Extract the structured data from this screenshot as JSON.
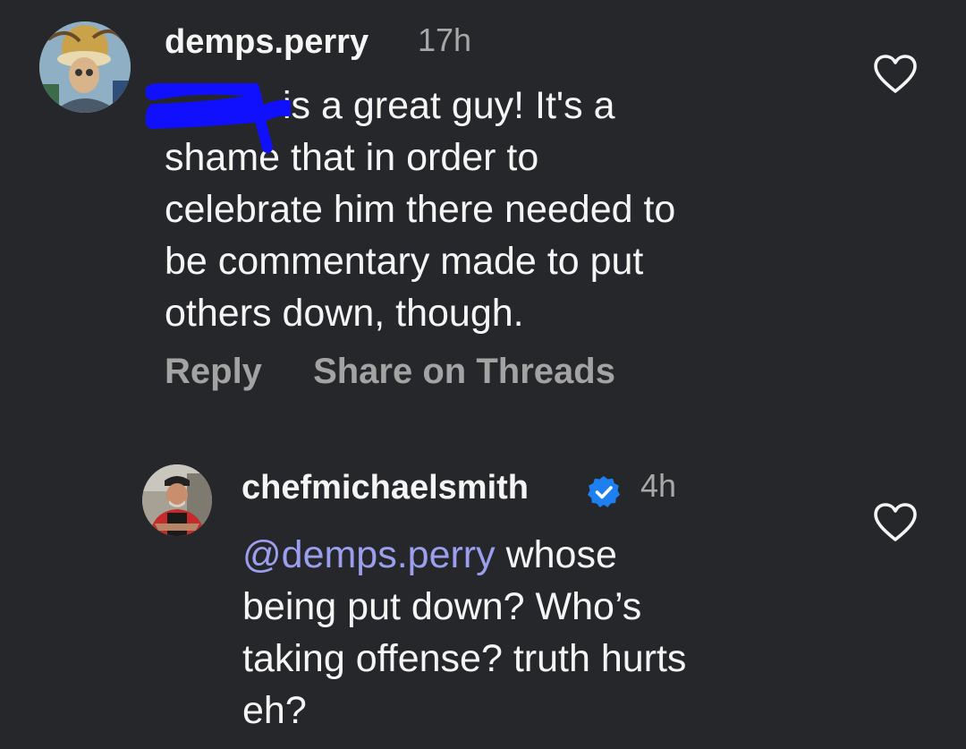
{
  "comments": [
    {
      "username": "demps.perry",
      "time": "17h",
      "lines": [
        "is a great guy! It's a",
        "shame that in order to",
        "celebrate him there needed to",
        "be commentary made to put",
        "others down, though."
      ],
      "actions": {
        "reply": "Reply",
        "share": "Share on Threads"
      }
    },
    {
      "username": "chefmichaelsmith",
      "verified": true,
      "time": "4h",
      "mention": "@demps.perry",
      "lines": [
        "whose",
        "being put down? Who’s",
        "taking offense? truth hurts",
        "eh?"
      ]
    }
  ],
  "colors": {
    "background": "#26272b",
    "mention": "#9b9fee",
    "verified": "#1d7ff0",
    "redaction": "#1010ff"
  }
}
